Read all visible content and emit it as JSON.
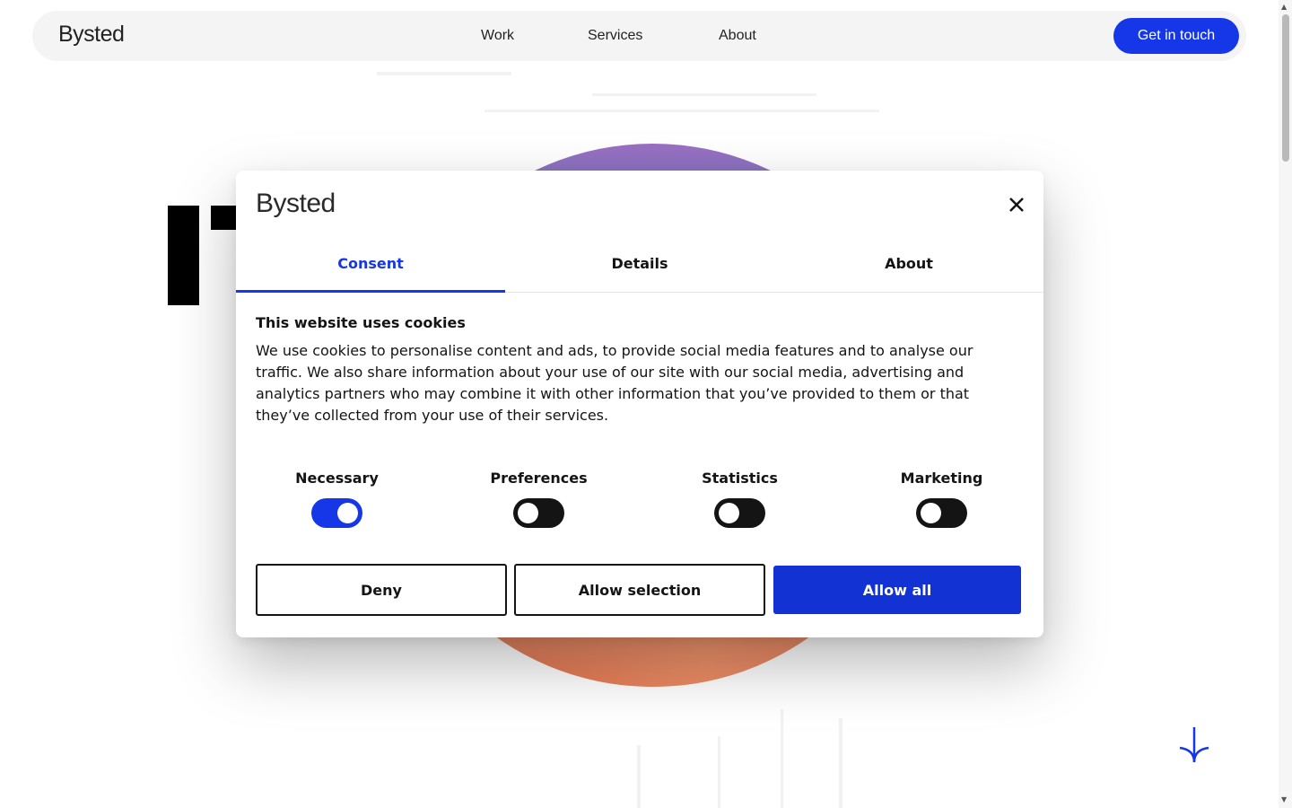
{
  "nav": {
    "logo": "Bysted",
    "links": [
      "Work",
      "Services",
      "About"
    ],
    "cta": "Get in touch"
  },
  "cookie_dialog": {
    "logo": "Bysted",
    "tabs": [
      {
        "label": "Consent",
        "active": true
      },
      {
        "label": "Details",
        "active": false
      },
      {
        "label": "About",
        "active": false
      }
    ],
    "title": "This website uses cookies",
    "body": "We use cookies to personalise content and ads, to provide social media features and to analyse our traffic. We also share information about your use of our site with our social media, advertising and analytics partners who may combine it with other information that you’ve provided to them or that they’ve collected from your use of their services.",
    "toggles": [
      {
        "label": "Necessary",
        "on": true
      },
      {
        "label": "Preferences",
        "on": false
      },
      {
        "label": "Statistics",
        "on": false
      },
      {
        "label": "Marketing",
        "on": false
      }
    ],
    "buttons": {
      "deny": "Deny",
      "allow_selection": "Allow selection",
      "allow_all": "Allow all"
    }
  },
  "colors": {
    "accent": "#1537e8",
    "allow_all": "#1232d4",
    "toggle_off": "#141414"
  },
  "icons": {
    "close": "close-icon",
    "scroll_down": "arrow-down-icon"
  }
}
